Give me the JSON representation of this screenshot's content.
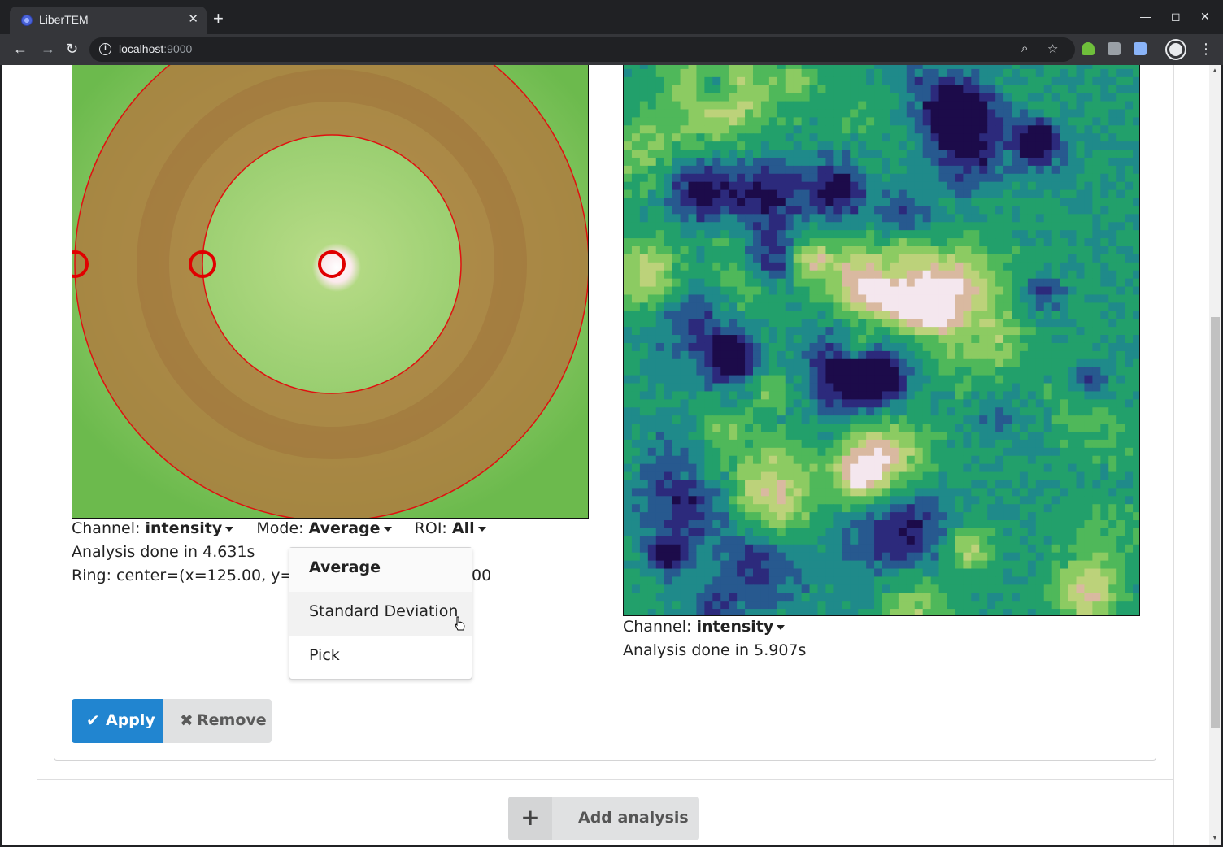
{
  "browser": {
    "tab_title": "LiberTEM",
    "url_host": "localhost",
    "url_port": ":9000"
  },
  "left_panel": {
    "channel_label": "Channel:",
    "channel_value": "intensity",
    "mode_label": "Mode:",
    "mode_value": "Average",
    "roi_label": "ROI:",
    "roi_value": "All",
    "status": "Analysis done in 4.631s",
    "ring_text_start": "Ring: center=(x=125.00, y=12",
    "ring_text_end": "00"
  },
  "mode_dropdown": {
    "options": [
      "Average",
      "Standard Deviation",
      "Pick"
    ],
    "selected": "Average",
    "hovered": "Standard Deviation"
  },
  "right_panel": {
    "channel_label": "Channel:",
    "channel_value": "intensity",
    "status": "Analysis done in 5.907s"
  },
  "actions": {
    "apply_label": "Apply",
    "remove_label": "Remove",
    "add_analysis_label": "Add analysis"
  },
  "colors": {
    "primary": "#2185d0",
    "secondary": "#e0e1e2",
    "ring_overlay": "#b07a3e",
    "ring_handle": "#e00000"
  }
}
